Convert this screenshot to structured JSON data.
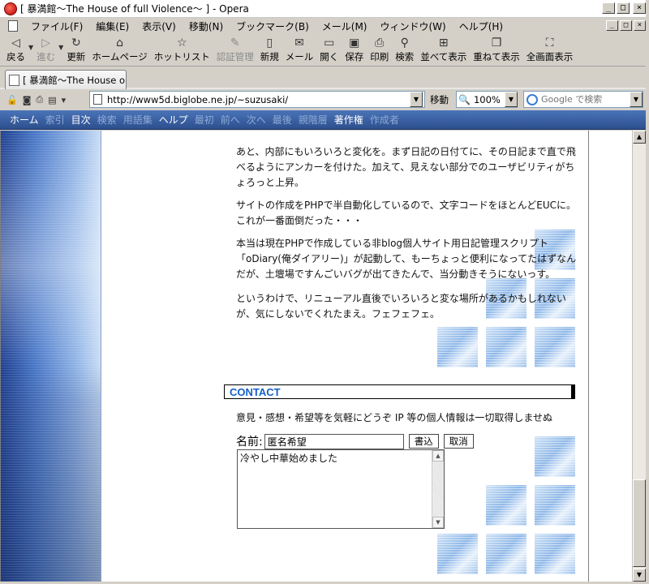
{
  "window": {
    "title": "[ 暴満館～The House of full Violence～ ] - Opera",
    "minimize": "_",
    "maximize": "□",
    "close": "×"
  },
  "menu": [
    {
      "label": "ファイル(F)",
      "name": "menu-file"
    },
    {
      "label": "編集(E)",
      "name": "menu-edit"
    },
    {
      "label": "表示(V)",
      "name": "menu-view"
    },
    {
      "label": "移動(N)",
      "name": "menu-navigate"
    },
    {
      "label": "ブックマーク(B)",
      "name": "menu-bookmarks"
    },
    {
      "label": "メール(M)",
      "name": "menu-mail"
    },
    {
      "label": "ウィンドウ(W)",
      "name": "menu-window"
    },
    {
      "label": "ヘルプ(H)",
      "name": "menu-help"
    }
  ],
  "toolbar": {
    "back": "戻る",
    "forward": "進む",
    "reload": "更新",
    "home": "ホームページ",
    "hotlist": "ホットリスト",
    "auth": "認証管理",
    "new": "新規",
    "mail": "メール",
    "open": "開く",
    "save": "保存",
    "print": "印刷",
    "find": "検索",
    "tile": "並べて表示",
    "cascade": "重ねて表示",
    "fullscreen": "全画面表示"
  },
  "tab": {
    "label": "[ 暴満館～The House o..."
  },
  "address": {
    "url": "http://www5d.biglobe.ne.jp/~suzusaki/",
    "go_label": "移動",
    "zoom": "100%",
    "search_placeholder": "Google で検索"
  },
  "sitenav": [
    {
      "label": "ホーム",
      "state": "on"
    },
    {
      "label": "索引",
      "state": "off"
    },
    {
      "label": "目次",
      "state": "on"
    },
    {
      "label": "検索",
      "state": "off"
    },
    {
      "label": "用語集",
      "state": "off"
    },
    {
      "label": "ヘルプ",
      "state": "on"
    },
    {
      "label": "最初",
      "state": "off"
    },
    {
      "label": "前へ",
      "state": "off"
    },
    {
      "label": "次へ",
      "state": "off"
    },
    {
      "label": "最後",
      "state": "off"
    },
    {
      "label": "親階層",
      "state": "off"
    },
    {
      "label": "著作権",
      "state": "on"
    },
    {
      "label": "作成者",
      "state": "off"
    }
  ],
  "content": {
    "p1": "あと、内部にもいろいろと変化を。まず日記の日付てに、その日記まで直で飛べるようにアンカーを付けた。加えて、見えない部分でのユーザビリティがちょろっと上昇。",
    "p2": "サイトの作成をPHPで半自動化しているので、文字コードをほとんどEUCに。これが一番面倒だった・・・",
    "p3": "本当は現在PHPで作成している非blog個人サイト用日記管理スクリプト「oDiary(俺ダイアリー)」が起動して、もーちょっと便利になってたはずなんだが、土壇場ですんごいバグが出てきたんで、当分動きそうにないっす。",
    "p4": "というわけで、リニューアル直後でいろいろと変な場所があるかもしれないが、気にしないでくれたまえ。フェフェフェ。",
    "contact_heading": "CONTACT",
    "contact_text": "意見・感想・希望等を気軽にどうぞ IP 等の個人情報は一切取得しませぬ",
    "name_label": "名前:",
    "name_value": "匿名希望",
    "submit_label": "書込",
    "cancel_label": "取消",
    "message_value": "冷やし中華始めました"
  }
}
